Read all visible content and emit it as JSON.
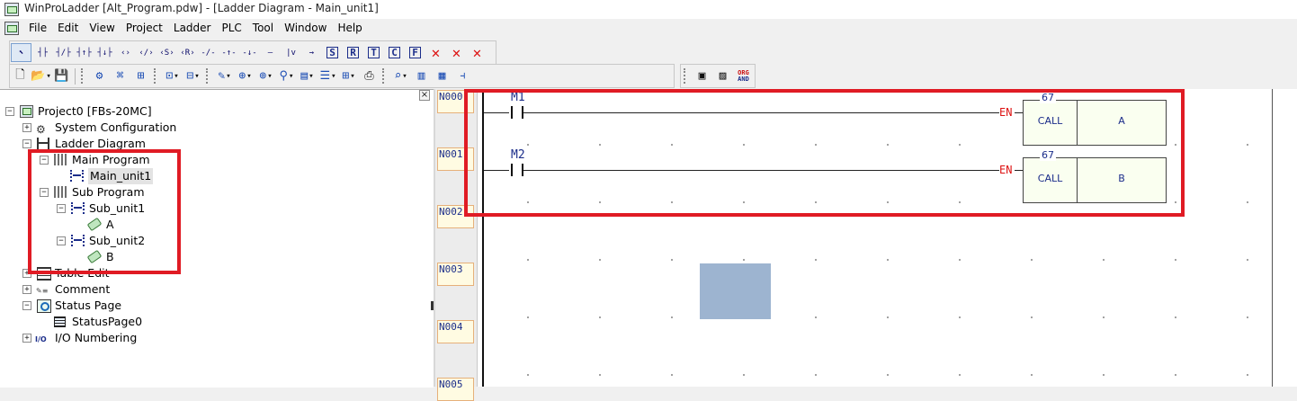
{
  "window": {
    "title": "WinProLadder [Alt_Program.pdw] - [Ladder Diagram - Main_unit1]"
  },
  "menu": {
    "items": [
      "File",
      "Edit",
      "View",
      "Project",
      "Ladder",
      "PLC",
      "Tool",
      "Window",
      "Help"
    ]
  },
  "toolbar1": {
    "box_labels": [
      "S",
      "R",
      "T",
      "C",
      "F"
    ],
    "glyphs": [
      "⬉",
      "┤├",
      "┤/├",
      "┤↑├",
      "┤↓├",
      "‹›",
      "‹/›",
      "‹S›",
      "‹R›",
      "-/-",
      "-↑-",
      "-↓-",
      "—",
      "|v",
      "→"
    ]
  },
  "toolbar3": {
    "org_and": [
      "ORG",
      "AND"
    ]
  },
  "tree": {
    "close_symbol": "×",
    "project": "Project0 [FBs-20MC]",
    "system_configuration": "System Configuration",
    "ladder_diagram": "Ladder Diagram",
    "main_program": "Main Program",
    "main_unit1": "Main_unit1",
    "sub_program": "Sub Program",
    "sub_unit1": "Sub_unit1",
    "a": "A",
    "sub_unit2": "Sub_unit2",
    "b": "B",
    "table_edit": "Table Edit",
    "comment": "Comment",
    "status_page": "Status Page",
    "status_page0": "StatusPage0",
    "io_numbering": "I/O Numbering",
    "expand_plus": "+",
    "expand_minus": "−"
  },
  "rows": [
    "N000",
    "N001",
    "N002",
    "N003",
    "N004",
    "N005"
  ],
  "ladder": {
    "rung1": {
      "contact": "M1",
      "en": "EN",
      "func_no": "67",
      "func": "CALL",
      "arg": "A"
    },
    "rung2": {
      "contact": "M2",
      "en": "EN",
      "func_no": "67",
      "func": "CALL",
      "arg": "B"
    }
  },
  "colors": {
    "highlight": "#e01b24",
    "selection_block": "#9db4d0",
    "label_blue": "#1b2d8a",
    "en_red": "#dd1111"
  }
}
